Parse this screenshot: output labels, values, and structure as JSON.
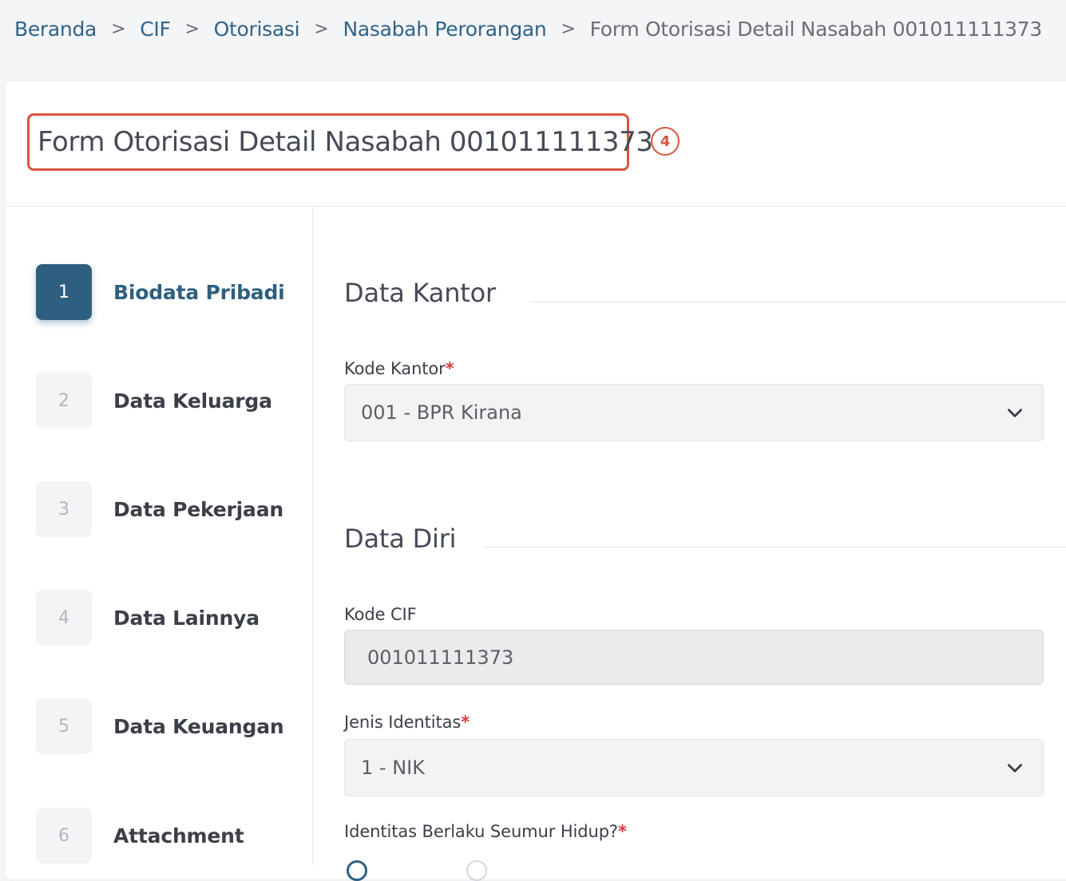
{
  "breadcrumb": {
    "items": [
      "Beranda",
      "CIF",
      "Otorisasi",
      "Nasabah Perorangan"
    ],
    "separator": ">",
    "current": "Form Otorisasi Detail Nasabah 001011111373"
  },
  "page": {
    "title": "Form Otorisasi Detail Nasabah 001011111373",
    "annotation": "4"
  },
  "steps": [
    {
      "number": "1",
      "label": "Biodata Pribadi",
      "active": true
    },
    {
      "number": "2",
      "label": "Data Keluarga",
      "active": false
    },
    {
      "number": "3",
      "label": "Data Pekerjaan",
      "active": false
    },
    {
      "number": "4",
      "label": "Data Lainnya",
      "active": false
    },
    {
      "number": "5",
      "label": "Data Keuangan",
      "active": false
    },
    {
      "number": "6",
      "label": "Attachment",
      "active": false
    }
  ],
  "sections": {
    "data_kantor": {
      "title": "Data Kantor",
      "kode_kantor": {
        "label": "Kode Kantor",
        "required": "*",
        "value": "001 - BPR Kirana"
      }
    },
    "data_diri": {
      "title": "Data Diri",
      "kode_cif": {
        "label": "Kode CIF",
        "value": "001011111373"
      },
      "jenis_identitas": {
        "label": "Jenis Identitas",
        "required": "*",
        "value": "1 - NIK"
      },
      "identitas_seumur_hidup": {
        "label": "Identitas Berlaku Seumur Hidup?",
        "required": "*"
      }
    }
  },
  "colors": {
    "accent": "#2f5f80",
    "annotation": "#d7553e",
    "required": "#d93b3b"
  }
}
